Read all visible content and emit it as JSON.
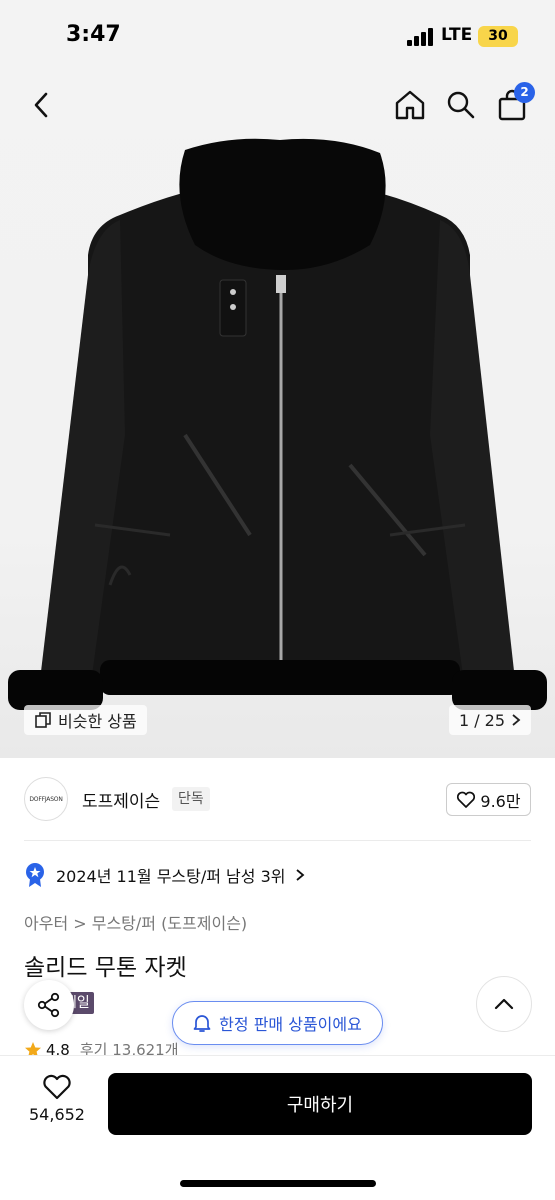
{
  "status_bar": {
    "time": "3:47",
    "network": "LTE",
    "battery": "30"
  },
  "nav": {
    "cart_count": "2",
    "icons": [
      "chevron-left-icon",
      "home-icon",
      "search-icon",
      "shopping-bag-icon"
    ]
  },
  "gallery": {
    "similar_label": "비슷한 상품",
    "page_indicator": "1 / 25"
  },
  "brand": {
    "logo_text": "DOFFJASON",
    "name": "도프제이슨",
    "tag": "단독",
    "likes": "9.6만"
  },
  "ranking": {
    "text": "2024년 11월 무스탕/퍼 남성 3위"
  },
  "breadcrumb": "아우터 > 무스탕/퍼 (도프제이슨)",
  "product": {
    "title": "솔리드 무톤 자켓",
    "sale_badge": "세일"
  },
  "limited_notice": "한정 판매 상품이에요",
  "rating": {
    "score": "4.8",
    "reviews": "후기 13,621개"
  },
  "bottom_bar": {
    "wish_count": "54,652",
    "buy_label": "구매하기"
  },
  "colors": {
    "accent_blue": "#2a63e8",
    "buy_button": "#000000",
    "sale_badge": "#5b4a6b",
    "battery": "#f8d54a"
  }
}
